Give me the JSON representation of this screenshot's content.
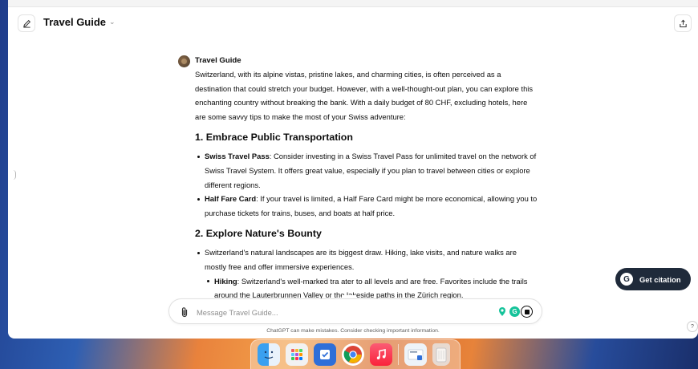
{
  "header": {
    "title": "Travel Guide",
    "edit_icon": "edit-icon",
    "share_icon": "share-icon"
  },
  "message": {
    "sender": "Travel Guide",
    "intro": "Switzerland, with its alpine vistas, pristine lakes, and charming cities, is often perceived as a destination that could stretch your budget. However, with a well-thought-out plan, you can explore this enchanting country without breaking the bank. With a daily budget of 80 CHF, excluding hotels, here are some savvy tips to make the most of your Swiss adventure:",
    "sections": [
      {
        "heading": "1. Embrace Public Transportation",
        "items": [
          {
            "bold": "Swiss Travel Pass",
            "text": ": Consider investing in a Swiss Travel Pass for unlimited travel on the network of Swiss Travel System. It offers great value, especially if you plan to travel between cities or explore different regions."
          },
          {
            "bold": "Half Fare Card",
            "text": ": If your travel is limited, a Half Fare Card might be more economical, allowing you to purchase tickets for trains, buses, and boats at half price."
          }
        ]
      },
      {
        "heading": "2. Explore Nature's Bounty",
        "items": [
          {
            "bold": "",
            "text": "Switzerland's natural landscapes are its biggest draw. Hiking, lake visits, and nature walks are mostly free and offer immersive experiences."
          },
          {
            "bold": "Hiking",
            "text": ": Switzerland's well-marked tra      ater to all levels and are free. Favorites include the trails around the Lauterbrunnen Valley or the lakeside paths in the Zürich region."
          }
        ]
      }
    ]
  },
  "input": {
    "placeholder": "Message Travel Guide..."
  },
  "disclaimer": "ChatGPT can make mistakes. Consider checking important information.",
  "help_label": "?",
  "citation": {
    "label": "Get citation",
    "icon_letter": "G"
  },
  "grammarly_letter": "G",
  "colors": {
    "citation_bg": "#1f2a3a",
    "grammarly_green": "#15c39a"
  }
}
